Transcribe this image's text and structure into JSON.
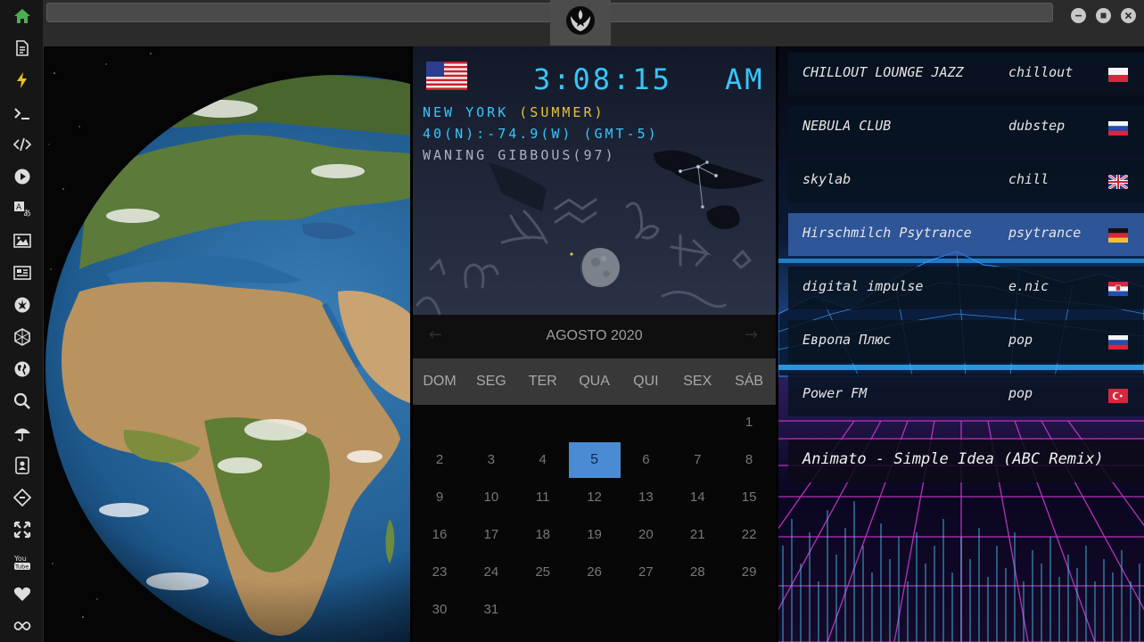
{
  "sidebar": {
    "icons": [
      "home-icon",
      "document-icon",
      "lightning-icon",
      "terminal-icon",
      "code-icon",
      "play-icon",
      "translate-icon",
      "image-icon",
      "news-icon",
      "rebel-emblem-icon",
      "hexagon-icon",
      "globe-icon",
      "search-icon",
      "umbrella-icon",
      "contacts-icon",
      "tag-icon",
      "expand-icon",
      "youtube-icon",
      "heart-icon",
      "infinity-icon"
    ],
    "active_color": "#4caf50"
  },
  "clock": {
    "time": "3:08:15",
    "ampm": "AM",
    "city": "NEW YORK",
    "season": "(SUMMER)",
    "coords": "40(N):-74.9(W) (GMT-5)",
    "moon": "WANING GIBBOUS(97)",
    "accent": "#36c6ff",
    "season_color": "#e6c23a"
  },
  "calendar": {
    "title": "AGOSTO 2020",
    "weekdays": [
      "DOM",
      "SEG",
      "TER",
      "QUA",
      "QUI",
      "SEX",
      "SÁB"
    ],
    "first_weekday_index": 6,
    "days_in_month": 31,
    "selected_day": 5,
    "selected_color": "#4a8bd4"
  },
  "radio": {
    "stations": [
      {
        "name": "CHILLOUT LOUNGE JAZZ",
        "genre": "chillout",
        "flag": "pl"
      },
      {
        "name": "NEBULA CLUB",
        "genre": "dubstep",
        "flag": "ru"
      },
      {
        "name": "skylab",
        "genre": "chill",
        "flag": "gb"
      },
      {
        "name": "Hirschmilch Psytrance",
        "genre": "psytrance",
        "flag": "de"
      },
      {
        "name": "digital impulse",
        "genre": "e.nic",
        "flag": "hr"
      },
      {
        "name": "Европа Плюс",
        "genre": "pop",
        "flag": "ru"
      },
      {
        "name": "Power FM",
        "genre": "pop",
        "flag": "tr"
      }
    ],
    "active_index": 3,
    "now_playing": "Animato - Simple Idea (ABC Remix)"
  }
}
